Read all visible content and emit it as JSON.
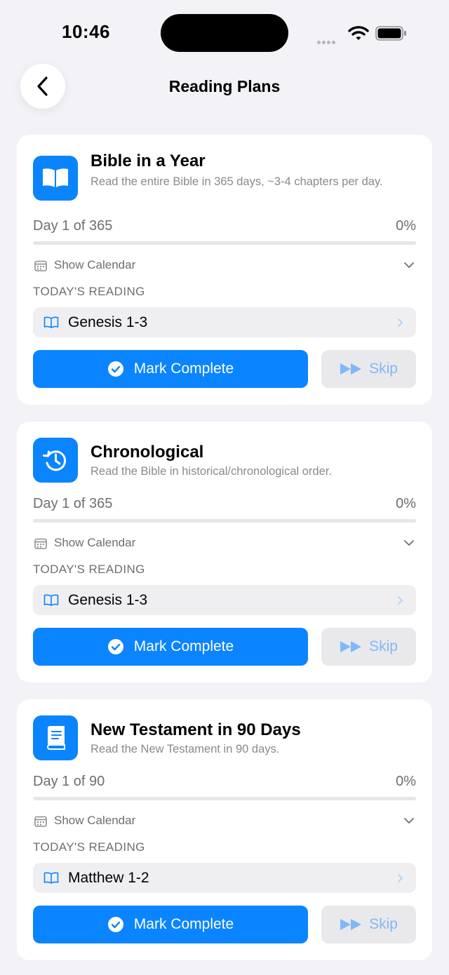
{
  "status_bar": {
    "time": "10:46"
  },
  "nav": {
    "title": "Reading Plans"
  },
  "labels": {
    "show_calendar": "Show Calendar",
    "todays_reading": "TODAY'S READING",
    "mark_complete": "Mark Complete",
    "skip": "Skip"
  },
  "colors": {
    "accent": "#0a84ff",
    "background": "#f2f2f7",
    "skip_text": "#7fb8f7"
  },
  "plans": [
    {
      "icon": "book-open-icon",
      "title": "Bible in a Year",
      "description": "Read the entire Bible in 365 days, ~3-4 chapters per day.",
      "day_text": "Day 1 of 365",
      "percent_text": "0%",
      "progress": 0,
      "todays_reading": "Genesis 1-3"
    },
    {
      "icon": "history-clock-icon",
      "title": "Chronological",
      "description": "Read the Bible in historical/chronological order.",
      "day_text": "Day 1 of 365",
      "percent_text": "0%",
      "progress": 0,
      "todays_reading": "Genesis 1-3"
    },
    {
      "icon": "closed-book-icon",
      "title": "New Testament in 90 Days",
      "description": "Read the New Testament in 90 days.",
      "day_text": "Day 1 of 90",
      "percent_text": "0%",
      "progress": 0,
      "todays_reading": "Matthew 1-2"
    }
  ]
}
